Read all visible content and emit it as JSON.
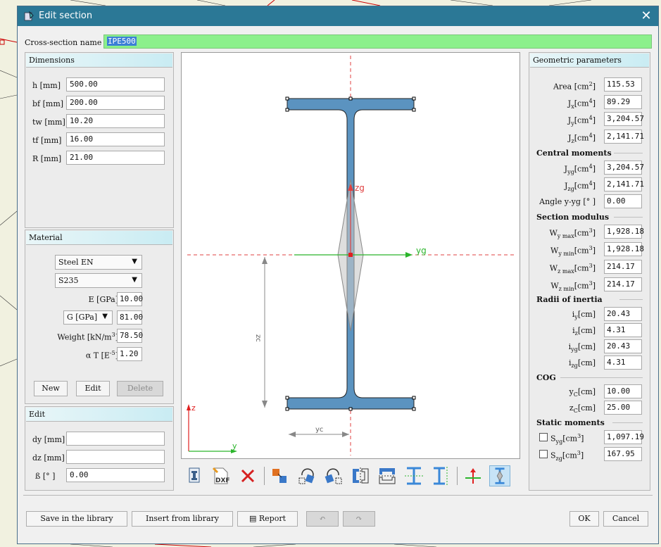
{
  "window": {
    "title": "Edit section",
    "close_icon": "close-icon"
  },
  "name": {
    "label": "Cross-section name",
    "value": "IPE500"
  },
  "dimensions": {
    "title": "Dimensions",
    "rows": [
      {
        "label": "h [mm]",
        "value": "500.00"
      },
      {
        "label": "bf [mm]",
        "value": "200.00"
      },
      {
        "label": "tw [mm]",
        "value": "10.20"
      },
      {
        "label": "tf [mm]",
        "value": "16.00"
      },
      {
        "label": "R [mm]",
        "value": "21.00"
      }
    ]
  },
  "material": {
    "title": "Material",
    "standard": "Steel EN",
    "grade": "S235",
    "e_label": "E [GPa]",
    "e_value": "10.00",
    "g_label": "G [GPa]",
    "g_value": "81.00",
    "weight_label": "Weight [kN/m",
    "weight_sup": "3",
    "weight_close": "]",
    "weight_value": "78.50",
    "alpha_label": "α T [E",
    "alpha_sup": "-5",
    "alpha_close": "]",
    "alpha_value": "1.20",
    "new_label": "New",
    "edit_label": "Edit",
    "delete_label": "Delete"
  },
  "edit": {
    "title": "Edit",
    "dy_label": "dy [mm]",
    "dy_value": "",
    "dz_label": "dz [mm]",
    "dz_value": "",
    "beta_label": "ß [° ]",
    "beta_value": "0.00"
  },
  "canvas": {
    "zg": "zg",
    "yg": "yg",
    "z": "z",
    "y": "y",
    "zc": "zc",
    "yc": "yc"
  },
  "geo": {
    "title": "Geometric parameters",
    "area": {
      "label": "Area [cm",
      "sup": "2",
      "close": "]",
      "value": "115.53"
    },
    "jx": {
      "label": "J",
      "sub": "x",
      "unit": "[cm",
      "sup": "4",
      "close": "]",
      "value": "89.29"
    },
    "jy": {
      "label": "J",
      "sub": "y",
      "unit": "[cm",
      "sup": "4",
      "close": "]",
      "value": "3,204.57"
    },
    "jz": {
      "label": "J",
      "sub": "z",
      "unit": "[cm",
      "sup": "4",
      "close": "]",
      "value": "2,141.71"
    },
    "central_title": "Central moments",
    "jyg": {
      "label": "J",
      "sub": "yg",
      "unit": "[cm",
      "sup": "4",
      "close": "]",
      "value": "3,204.57"
    },
    "jzg": {
      "label": "J",
      "sub": "zg",
      "unit": "[cm",
      "sup": "4",
      "close": "]",
      "value": "2,141.71"
    },
    "angle": {
      "label": "Angle y-yg [° ]",
      "value": "0.00"
    },
    "modulus_title": "Section modulus",
    "wymax": {
      "label": "W",
      "sub": "y max",
      "unit": "[cm",
      "sup": "3",
      "close": "]",
      "value": "1,928.18"
    },
    "wymin": {
      "label": "W",
      "sub": "y min",
      "unit": "[cm",
      "sup": "3",
      "close": "]",
      "value": "1,928.18"
    },
    "wzmax": {
      "label": "W",
      "sub": "z max",
      "unit": "[cm",
      "sup": "3",
      "close": "]",
      "value": "214.17"
    },
    "wzmin": {
      "label": "W",
      "sub": "z min",
      "unit": "[cm",
      "sup": "3",
      "close": "]",
      "value": "214.17"
    },
    "radii_title": "Radii of inertia",
    "iy": {
      "label": "i",
      "sub": "y",
      "unit": "[cm]",
      "value": "20.43"
    },
    "iz": {
      "label": "i",
      "sub": "z",
      "unit": "[cm]",
      "value": "4.31"
    },
    "iyg": {
      "label": "i",
      "sub": "yg",
      "unit": "[cm]",
      "value": "20.43"
    },
    "izg": {
      "label": "i",
      "sub": "zg",
      "unit": "[cm]",
      "value": "4.31"
    },
    "cog_title": "COG",
    "yc": {
      "label": "y",
      "sub": "C",
      "unit": "[cm]",
      "value": "10.00"
    },
    "zc": {
      "label": "z",
      "sub": "C",
      "unit": "[cm]",
      "value": "25.00"
    },
    "static_title": "Static moments",
    "syg": {
      "label": "S",
      "sub": "yg",
      "unit": "[cm",
      "sup": "3",
      "close": "]",
      "value": "1,097.19",
      "checked": false
    },
    "szg": {
      "label": "S",
      "sub": "zg",
      "unit": "[cm",
      "sup": "3",
      "close": "]",
      "value": "167.95",
      "checked": false
    }
  },
  "footer": {
    "save_label": "Save in the library",
    "insert_label": "Insert from library",
    "report_label": "Report",
    "ok_label": "OK",
    "cancel_label": "Cancel"
  },
  "toolbar": {
    "icons": [
      "import-section-icon",
      "dxf-icon",
      "delete-icon",
      "copy-icon",
      "rotate-left-icon",
      "rotate-right-icon",
      "mirror-vertical-icon",
      "mirror-horizontal-icon",
      "i-beam-horizontal-icon",
      "i-beam-vertical-icon",
      "axes-icon",
      "stress-diagram-icon"
    ],
    "dxf_text": "DXF"
  },
  "colors": {
    "titlebar": "#2b7896",
    "section_fill": "#5b93c0",
    "name_field": "#8cf08c",
    "panel_header": "#c9ecf3"
  }
}
